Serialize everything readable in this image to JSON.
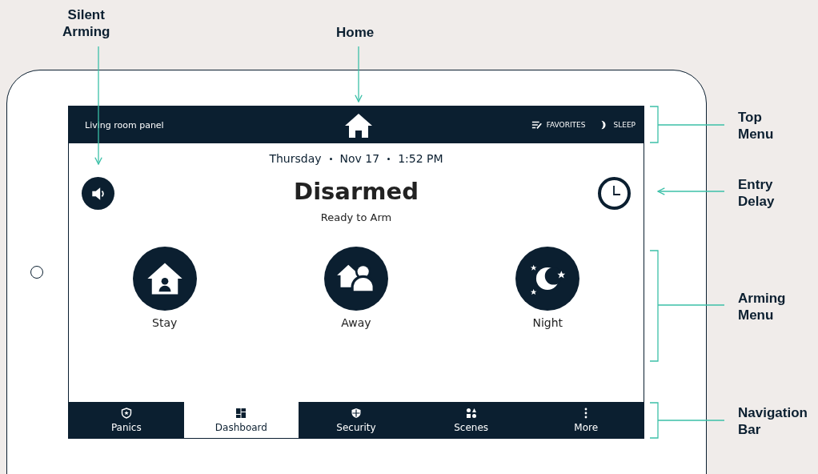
{
  "callouts": [
    {
      "label": "Silent Arming"
    },
    {
      "label": "Home"
    },
    {
      "label": "Top Menu"
    },
    {
      "label": "Entry Delay"
    },
    {
      "label": "Arming Menu"
    },
    {
      "label": "Navigation Bar"
    }
  ],
  "top_menu": {
    "panel_name": "Living room panel",
    "favorites": "FAVORITES",
    "sleep": "SLEEP"
  },
  "date_line": [
    "Thursday",
    "Nov 17",
    "1:52 PM"
  ],
  "status": {
    "title": "Disarmed",
    "subtitle": "Ready to Arm"
  },
  "arming_modes": [
    {
      "kind": "stay",
      "label": "Stay"
    },
    {
      "kind": "away",
      "label": "Away"
    },
    {
      "kind": "night",
      "label": "Night"
    }
  ],
  "nav_tabs": [
    {
      "kind": "panics",
      "label": "Panics",
      "selected": false
    },
    {
      "kind": "dashboard",
      "label": "Dashboard",
      "selected": true
    },
    {
      "kind": "security",
      "label": "Security",
      "selected": false
    },
    {
      "kind": "scenes",
      "label": "Scenes",
      "selected": false
    },
    {
      "kind": "more",
      "label": "More",
      "selected": false
    }
  ]
}
